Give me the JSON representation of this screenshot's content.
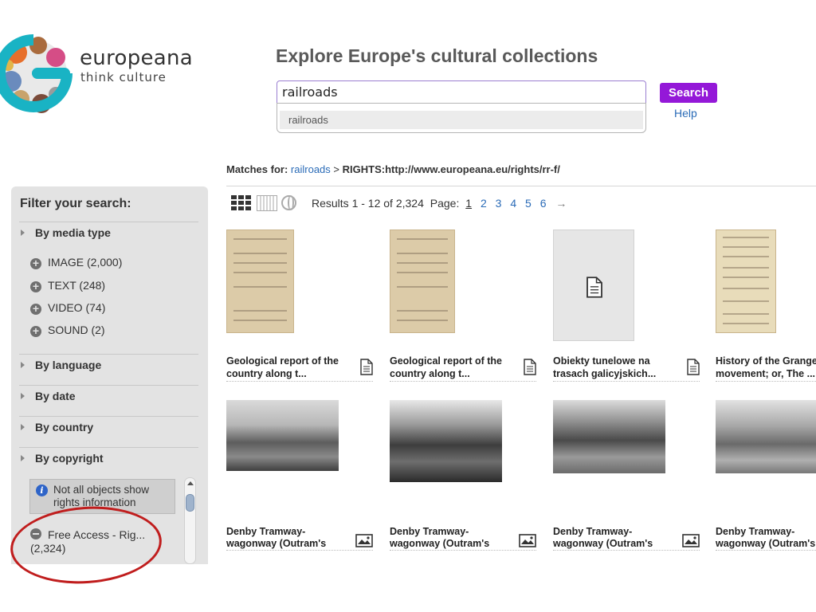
{
  "brand": {
    "name": "europeana",
    "tagline": "think culture"
  },
  "header": {
    "headline": "Explore Europe's cultural collections",
    "search_value": "railroads",
    "suggestion": "railroads",
    "search_label": "Search",
    "help_label": "Help"
  },
  "matches": {
    "prefix": "Matches for:",
    "term": "railroads",
    "separator": ">",
    "rights": "RIGHTS:http://www.europeana.eu/rights/rr-f/"
  },
  "sidebar": {
    "title": "Filter your search:",
    "facets": [
      {
        "label": "By media type"
      },
      {
        "label": "By language"
      },
      {
        "label": "By date"
      },
      {
        "label": "By country"
      },
      {
        "label": "By copyright"
      }
    ],
    "media_types": [
      {
        "label": "IMAGE (2,000)"
      },
      {
        "label": "TEXT (248)"
      },
      {
        "label": "VIDEO (74)"
      },
      {
        "label": "SOUND (2)"
      }
    ],
    "notice": "Not all objects show rights information",
    "selected_filter": {
      "label": "Free Access - Rig...",
      "count": "(2,324)"
    }
  },
  "toolbar": {
    "results_text": "Results 1 - 12 of 2,324",
    "page_label": "Page:",
    "pages": [
      "1",
      "2",
      "3",
      "4",
      "5",
      "6"
    ],
    "current_page": "1",
    "next_arrow": "→"
  },
  "results": [
    {
      "title1": "Geological report of the",
      "title2": "country along t...",
      "icon": "document-icon",
      "thumb": "document-scan"
    },
    {
      "title1": "Geological report of the",
      "title2": "country along t...",
      "icon": "document-icon",
      "thumb": "document-scan"
    },
    {
      "title1": "Obiekty tunelowe na",
      "title2": "trasach galicyjskich...",
      "icon": "document-icon",
      "thumb": "placeholder"
    },
    {
      "title1": "History of the Grange",
      "title2": "movement; or, The ...",
      "icon": "document-icon",
      "thumb": "document-scan"
    },
    {
      "title1": "Denby Tramway-",
      "title2": "wagonway (Outram's",
      "icon": "image-icon",
      "thumb": "photo"
    },
    {
      "title1": "Denby Tramway-",
      "title2": "wagonway (Outram's",
      "icon": "image-icon",
      "thumb": "photo"
    },
    {
      "title1": "Denby Tramway-",
      "title2": "wagonway (Outram's",
      "icon": "image-icon",
      "thumb": "photo"
    },
    {
      "title1": "Denby Tramway-",
      "title2": "wagonway (Outram's",
      "icon": "image-icon",
      "thumb": "photo"
    }
  ],
  "colors": {
    "accent": "#9418d8",
    "link": "#2a6bb7",
    "annotation": "#c01d1d",
    "logo_teal": "#19b3c4"
  }
}
